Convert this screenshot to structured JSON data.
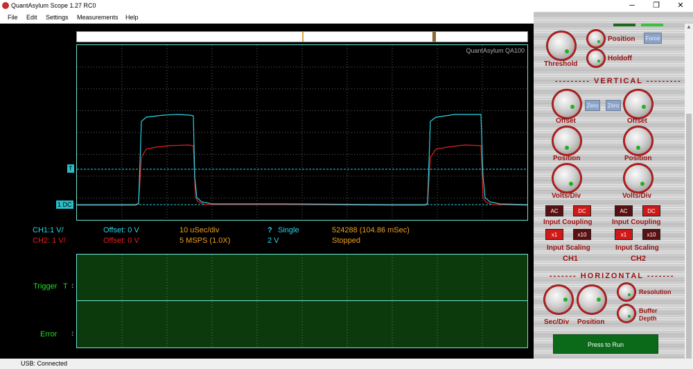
{
  "window": {
    "title": "QuantAsylum Scope 1.27 RC0"
  },
  "menu": [
    "File",
    "Edit",
    "Settings",
    "Measurements",
    "Help"
  ],
  "status": {
    "text": "USB: Connected"
  },
  "scope": {
    "brand": "QuantAsylum QA100",
    "trigger_flag": "T",
    "channel_flag": "1 DC",
    "colors": {
      "ch1": "#2ad6e6",
      "ch2": "#e32020",
      "trigger_line": "#2ad6e6"
    }
  },
  "info": {
    "ch1": "CH1:1 V/",
    "ch2": "CH2: 1 V/",
    "offset1": "Offset: 0 V",
    "offset2": "Offset: 0 V",
    "timebase": "10 uSec/div",
    "samplerate": "5 MSPS (1.0X)",
    "trig_mark": "?",
    "trig_mode": "Single",
    "trig_level": "2 V",
    "buffer": "524288 (104.86 mSec)",
    "run_state": "Stopped"
  },
  "lower": {
    "trigger_label": "Trigger",
    "trigger_flag": "T",
    "error_label": "Error"
  },
  "controls": {
    "threshold": "Threshold",
    "position": "Position",
    "holdoff": "Holdoff",
    "force": "Force",
    "vertical": "--------- VERTICAL ---------",
    "zero": "Zero",
    "offset": "Offset",
    "vposition": "Position",
    "voltsdiv": "Volts/Div",
    "ac": "AC",
    "dc": "DC",
    "input_coupling": "Input Coupling",
    "x1": "x1",
    "x10": "x10",
    "input_scaling": "Input Scaling",
    "ch1": "CH1",
    "ch2": "CH2",
    "horizontal": "------- HORIZONTAL -------",
    "resolution": "Resolution",
    "buffer_depth_1": "Buffer",
    "buffer_depth_2": "Depth",
    "secdiv": "Sec/Div",
    "hposition": "Position",
    "run": "Press to Run"
  }
}
